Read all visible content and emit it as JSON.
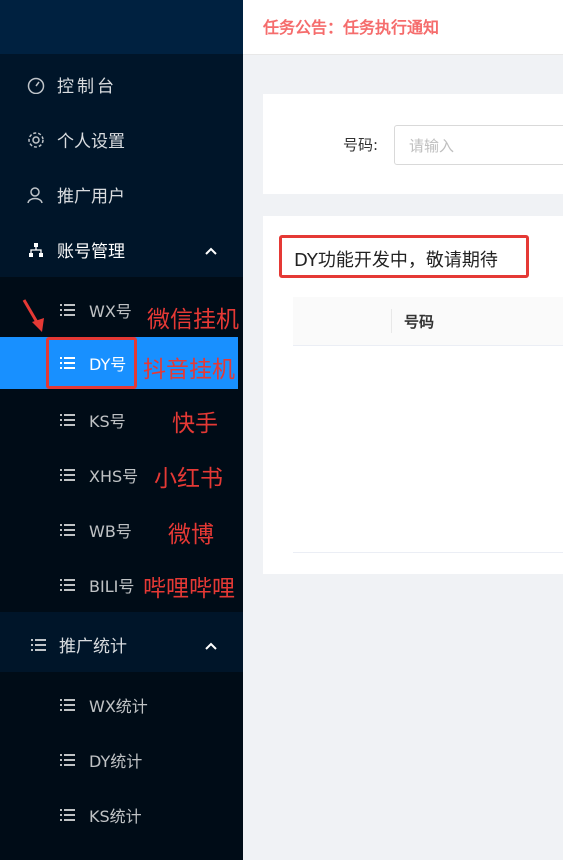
{
  "notice": "任务公告：任务执行通知",
  "sidebar": {
    "dashboard": "控制台",
    "personal_settings": "个人设置",
    "promote_users": "推广用户",
    "account_mgmt": {
      "label": "账号管理",
      "items": [
        "WX号",
        "DY号",
        "KS号",
        "XHS号",
        "WB号",
        "BILI号"
      ]
    },
    "promote_stats": {
      "label": "推广统计",
      "items": [
        "WX统计",
        "DY统计",
        "KS统计"
      ]
    }
  },
  "search": {
    "label": "号码:",
    "placeholder": "请输入"
  },
  "message": "DY功能开发中，敬请期待",
  "table": {
    "columns": [
      "号码"
    ]
  },
  "annotations": [
    "微信挂机",
    "抖音挂机",
    "快手",
    "小红书",
    "微博",
    "哔哩哔哩"
  ],
  "colors": {
    "sidebar_bg": "#001529",
    "selected": "#1890ff",
    "annotation_red": "#e53935",
    "notice_red": "#f56c6c"
  }
}
